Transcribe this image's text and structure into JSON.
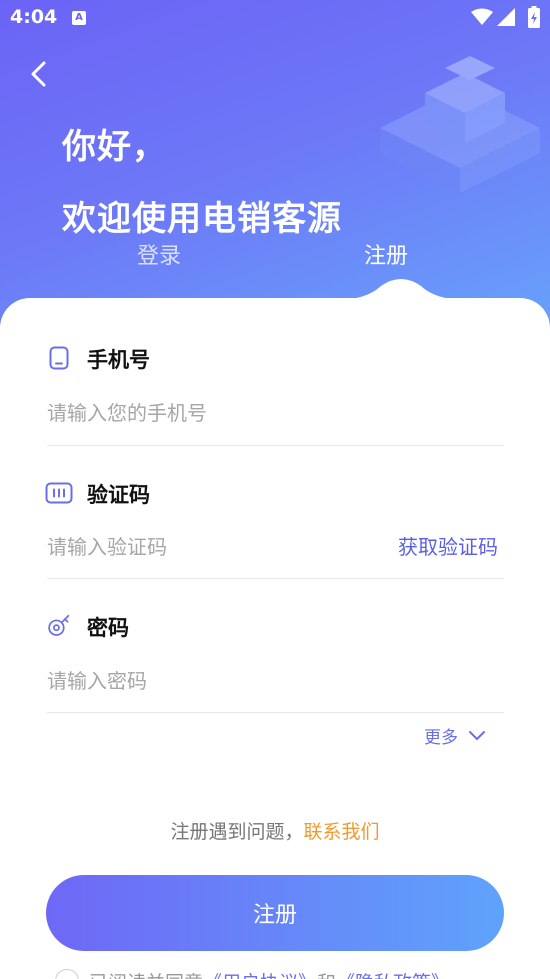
{
  "status_bar": {
    "time": "4:04",
    "notification": "A"
  },
  "header": {
    "greeting_line1": "你好，",
    "greeting_line2": "欢迎使用电销客源",
    "tabs": [
      {
        "label": "登录",
        "active": false
      },
      {
        "label": "注册",
        "active": true
      }
    ]
  },
  "form": {
    "phone": {
      "label": "手机号",
      "placeholder": "请输入您的手机号",
      "value": ""
    },
    "code": {
      "label": "验证码",
      "placeholder": "请输入验证码",
      "value": "",
      "get_code_label": "获取验证码"
    },
    "password": {
      "label": "密码",
      "placeholder": "请输入密码",
      "value": ""
    },
    "more_label": "更多"
  },
  "help": {
    "text": "注册遇到问题，",
    "contact_label": "联系我们"
  },
  "submit_label": "注册",
  "agreement": {
    "prefix": "已阅读并同意",
    "user_agreement": "《用户协议》",
    "and": "和",
    "privacy_policy": "《隐私政策》"
  },
  "colors": {
    "accent": "#6a6ee8",
    "header_start": "#6b63f6",
    "header_end": "#67a6fb",
    "contact": "#f29a2e"
  }
}
